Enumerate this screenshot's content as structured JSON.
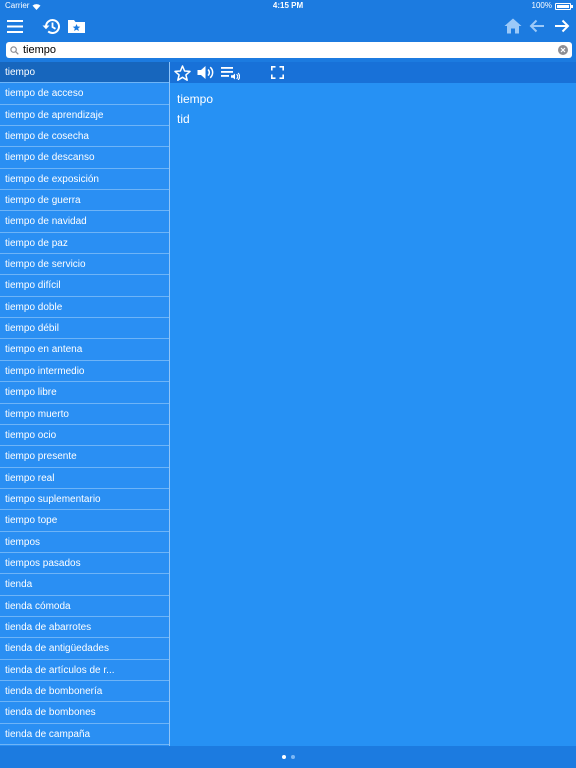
{
  "status": {
    "carrier": "Carrier",
    "time": "4:15 PM",
    "battery": "100%",
    "battery_level": 1.0
  },
  "navbar": {
    "icons": [
      "menu-icon",
      "history-icon",
      "bookmarks-icon",
      "home-icon",
      "back-arrow-icon",
      "forward-arrow-icon"
    ]
  },
  "search": {
    "value": "tiempo",
    "placeholder": ""
  },
  "sidebar": {
    "items": [
      "tiempo",
      "tiempo de acceso",
      "tiempo de aprendizaje",
      "tiempo de cosecha",
      "tiempo de descanso",
      "tiempo de exposición",
      "tiempo de guerra",
      "tiempo de navidad",
      "tiempo de paz",
      "tiempo de servicio",
      "tiempo difícil",
      "tiempo doble",
      "tiempo débil",
      "tiempo en antena",
      "tiempo intermedio",
      "tiempo libre",
      "tiempo muerto",
      "tiempo ocio",
      "tiempo presente",
      "tiempo real",
      "tiempo suplementario",
      "tiempo tope",
      "tiempos",
      "tiempos pasados",
      "tienda",
      "tienda cómoda",
      "tienda de abarrotes",
      "tienda de antigüedades",
      "tienda de artículos de r...",
      "tienda de bombonería",
      "tienda de bombones",
      "tienda de campaña"
    ],
    "selected_index": 0
  },
  "toolbar": {
    "icons": [
      "star-icon",
      "speaker-icon",
      "playlist-audio-icon",
      "fullscreen-icon"
    ]
  },
  "entry": {
    "word": "tiempo",
    "translation": "tid"
  },
  "pager": {
    "pages": 2,
    "current": 0
  },
  "colors": {
    "primary": "#1c7be0",
    "sidebar": "#2a8ff3",
    "selected": "#1766bd",
    "content": "#2691f4",
    "toolbar": "#1871d8"
  }
}
